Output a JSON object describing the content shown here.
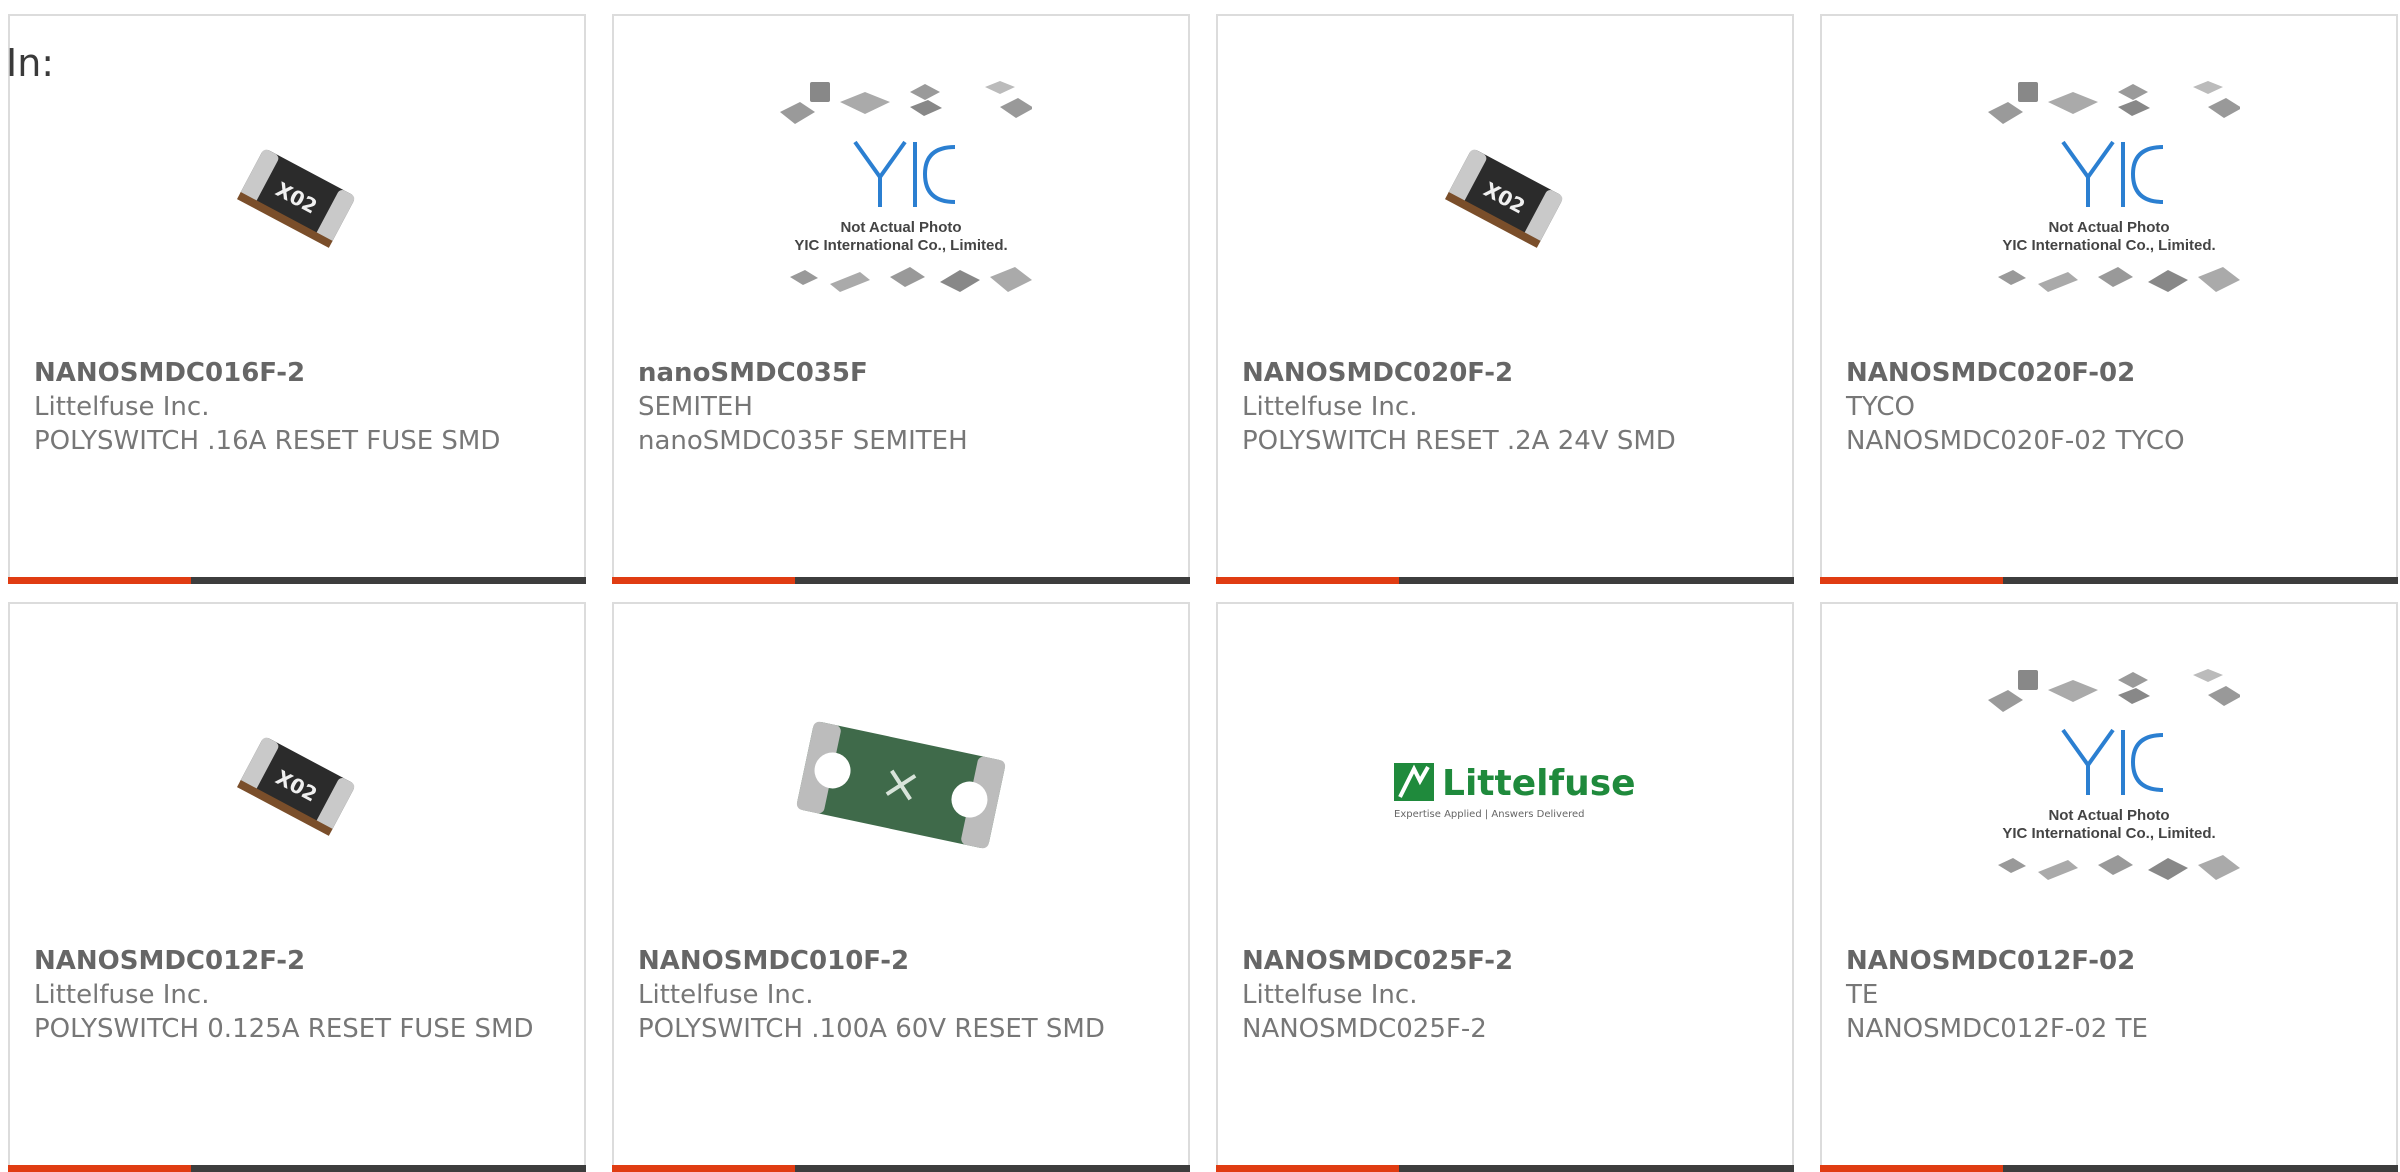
{
  "header": {
    "in_label": "In:"
  },
  "products": [
    {
      "part_number": "NANOSMDC016F-2",
      "manufacturer": "Littelfuse Inc.",
      "description": "POLYSWITCH .16A RESET FUSE SMD",
      "image": "chip-fuse-photo"
    },
    {
      "part_number": "nanoSMDC035F",
      "manufacturer": "SEMITEH",
      "description": "nanoSMDC035F SEMITEH",
      "image": "yic-placeholder",
      "image_text": [
        "Not Actual Photo",
        "YIC International Co., Limited."
      ]
    },
    {
      "part_number": "NANOSMDC020F-2",
      "manufacturer": "Littelfuse Inc.",
      "description": "POLYSWITCH RESET .2A 24V SMD",
      "image": "chip-fuse-photo"
    },
    {
      "part_number": "NANOSMDC020F-02",
      "manufacturer": "TYCO",
      "description": "NANOSMDC020F-02 TYCO",
      "image": "yic-placeholder",
      "image_text": [
        "Not Actual Photo",
        "YIC International Co., Limited."
      ]
    },
    {
      "part_number": "NANOSMDC012F-2",
      "manufacturer": "Littelfuse Inc.",
      "description": "POLYSWITCH 0.125A RESET FUSE SMD",
      "image": "chip-fuse-photo"
    },
    {
      "part_number": "NANOSMDC010F-2",
      "manufacturer": "Littelfuse Inc.",
      "description": "POLYSWITCH .100A 60V RESET SMD",
      "image": "green-fuse-photo"
    },
    {
      "part_number": "NANOSMDC025F-2",
      "manufacturer": "Littelfuse Inc.",
      "description": "NANOSMDC025F-2",
      "image": "littelfuse-logo",
      "logo_text": [
        "Littelfuse",
        "Expertise Applied | Answers Delivered"
      ]
    },
    {
      "part_number": "NANOSMDC012F-02",
      "manufacturer": "TE",
      "description": "NANOSMDC012F-02 TE",
      "image": "yic-placeholder",
      "image_text": [
        "Not Actual Photo",
        "YIC International Co., Limited."
      ]
    }
  ],
  "colors": {
    "accent": "#e03c12",
    "bar": "#3d3d3d",
    "border": "#dcdcdc",
    "text": "#666666"
  }
}
